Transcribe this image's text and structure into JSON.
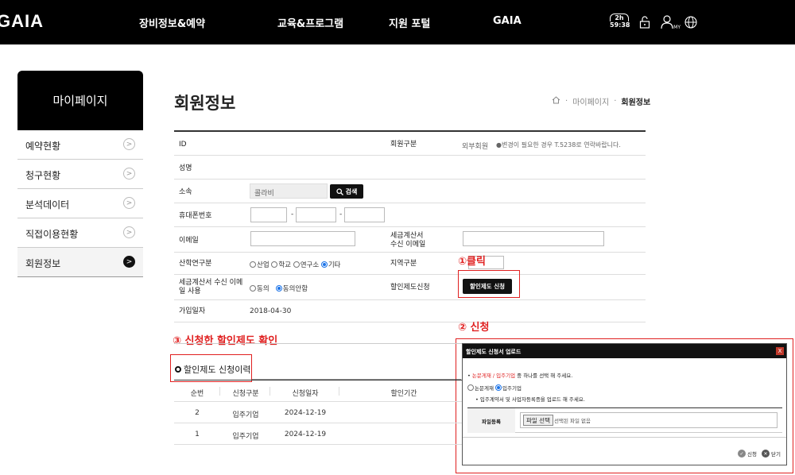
{
  "nav": {
    "logo": "GAIA",
    "menu": [
      "장비정보&예약",
      "교육&프로그램",
      "지원 포털",
      "GAIA"
    ],
    "timer_top": "2h",
    "timer_bottom": "59:38",
    "my_label": "MY"
  },
  "sidebar": {
    "title": "마이페이지",
    "items": [
      {
        "label": "예약현황"
      },
      {
        "label": "청구현황"
      },
      {
        "label": "분석데이터"
      },
      {
        "label": "직접이용현황"
      },
      {
        "label": "회원정보"
      }
    ]
  },
  "page": {
    "title": "회원정보",
    "breadcrumb": [
      "마이페이지",
      "회원정보"
    ]
  },
  "form": {
    "id_label": "ID",
    "member_type_label": "회원구분",
    "member_type_value": "외부회원",
    "member_type_note": "●변경이 필요한 경우 T.5238로 연락바랍니다.",
    "name_label": "성명",
    "org_label": "소속",
    "org_value": "콜라비",
    "search_button": "검색",
    "phone_label": "휴대폰번호",
    "phone_sep": "-",
    "email_label": "이메일",
    "tax_email_label_1": "세금계산서",
    "tax_email_label_2": "수신 이메일",
    "research_label": "산학연구분",
    "research_options": [
      "산업",
      "학교",
      "연구소",
      "기타"
    ],
    "region_label": "지역구분",
    "tax_receive_label_1": "세금계산서 수신 이메",
    "tax_receive_label_2": "일 사용",
    "tax_receive_options": [
      "동의",
      "동의안함"
    ],
    "discount_label": "할인제도신청",
    "discount_button": "할인제도 신청",
    "join_date_label": "가입일자",
    "join_date_value": "2018-04-30"
  },
  "annotations": {
    "step1": "①클릭",
    "step2": "② 신청",
    "step3": "③ 신청한 할인제도 확인"
  },
  "history": {
    "title": "할인제도 신청이력",
    "columns": [
      "순번",
      "신청구분",
      "신청일자",
      "할인기간"
    ],
    "rows": [
      {
        "no": "2",
        "type": "입주기업",
        "date": "2024-12-19"
      },
      {
        "no": "1",
        "type": "입주기업",
        "date": "2024-12-19"
      }
    ]
  },
  "modal": {
    "title": "할인제도 신청서 업로드",
    "instruction_red": "논문게재 / 입주기업",
    "instruction_rest": " 중 하나를 선택 해 주세요.",
    "options": [
      "논문게재",
      "입주기업"
    ],
    "note": "입주계약서 및 사업자등록증을 업로드 해 주세요.",
    "file_label": "파일등록",
    "file_button": "파일 선택",
    "file_status": "선택된 파일 없음",
    "submit_label": "신청",
    "close_label": "닫기",
    "close_x": "X"
  },
  "colors": {
    "accent_red": "#e02020",
    "radio_blue": "#1a73e8",
    "nav_bg": "#000000"
  }
}
